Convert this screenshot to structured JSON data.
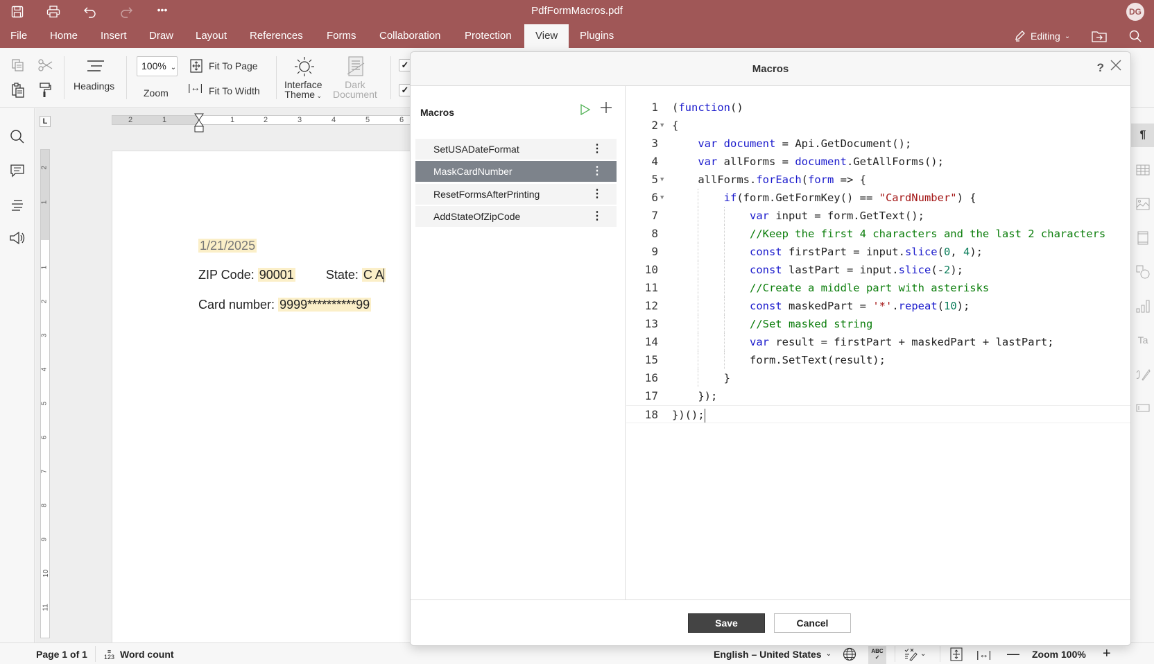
{
  "titlebar": {
    "document_title": "PdfFormMacros.pdf",
    "avatar_initials": "DG",
    "quick_actions": [
      "save-icon",
      "print-icon",
      "undo-icon",
      "redo-icon",
      "more-icon"
    ]
  },
  "menu": {
    "tabs": [
      "File",
      "Home",
      "Insert",
      "Draw",
      "Layout",
      "References",
      "Forms",
      "Collaboration",
      "Protection",
      "View",
      "Plugins"
    ],
    "active_tab": "View",
    "editing_label": "Editing"
  },
  "ribbon": {
    "headings_label": "Headings",
    "zoom_value": "100%",
    "zoom_label": "Zoom",
    "fit_page_label": "Fit To Page",
    "fit_width_label": "Fit To Width",
    "interface_theme_label_1": "Interface",
    "interface_theme_label_2": "Theme",
    "dark_document_label_1": "Dark",
    "dark_document_label_2": "Document"
  },
  "rulers": {
    "horizontal_ticks": [
      "2",
      "1",
      "1",
      "2",
      "3",
      "4",
      "5",
      "6"
    ],
    "vertical_ticks": [
      "2",
      "1",
      "1",
      "2",
      "3",
      "4",
      "5",
      "6",
      "7",
      "8",
      "9",
      "10",
      "11"
    ],
    "tab_stop": "L"
  },
  "document": {
    "date_value": "1/21/2025",
    "zip_label": "ZIP Code:",
    "zip_value": "90001",
    "state_label": "State:",
    "state_value": "C A",
    "card_label": "Card number:",
    "card_value": "9999**********99"
  },
  "dialog": {
    "title": "Macros",
    "help": "?",
    "panel_title": "Macros",
    "macros": [
      {
        "name": "SetUSADateFormat",
        "selected": false
      },
      {
        "name": "MaskCardNumber",
        "selected": true
      },
      {
        "name": "ResetFormsAfterPrinting",
        "selected": false
      },
      {
        "name": "AddStateOfZipCode",
        "selected": false
      }
    ],
    "code_lines": [
      "(function()",
      "{",
      "    var document = Api.GetDocument();",
      "    var allForms = document.GetAllForms();",
      "    allForms.forEach(form => {",
      "        if(form.GetFormKey() == \"CardNumber\") {",
      "            var input = form.GetText();",
      "            //Keep the first 4 characters and the last 2 characters",
      "            const firstPart = input.slice(0, 4);",
      "            const lastPart = input.slice(-2);",
      "            //Create a middle part with asterisks",
      "            const maskedPart = '*'.repeat(10);",
      "            //Set masked string",
      "            var result = firstPart + maskedPart + lastPart;",
      "            form.SetText(result);",
      "        }",
      "    });",
      "})();"
    ],
    "foldable_lines": [
      2,
      5,
      6
    ],
    "current_line": 18,
    "save_label": "Save",
    "cancel_label": "Cancel"
  },
  "statusbar": {
    "page_info": "Page 1 of 1",
    "word_count_label": "Word count",
    "language": "English – United States",
    "zoom_label": "Zoom 100%"
  }
}
